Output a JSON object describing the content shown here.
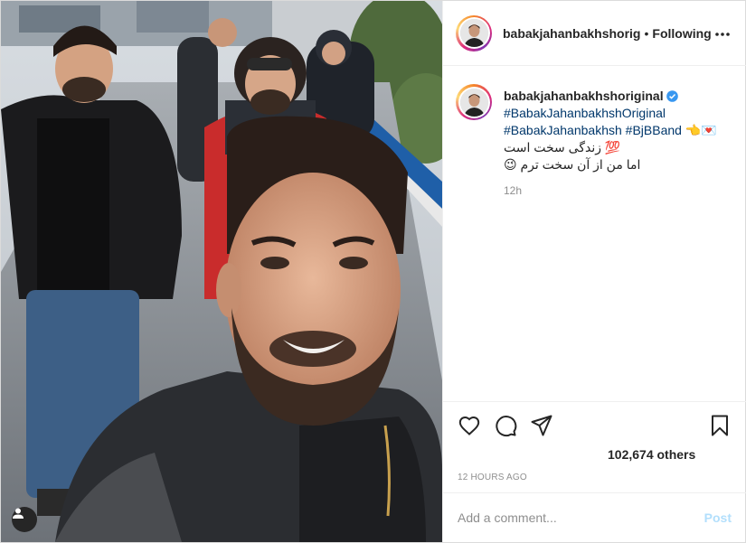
{
  "post": {
    "photo_alt_icon": "user-tag-icon",
    "header": {
      "username": "babakjahanbakhshorig",
      "separator": "•",
      "follow_status": "Following",
      "more_icon": "ellipsis-icon"
    },
    "caption": {
      "username": "babakjahanbakhshoriginal",
      "verified_icon": "verified-badge-icon",
      "hashtag_1": "#BabakJahanbakhshOriginal",
      "hashtag_2": "#BabakJahanbakhsh",
      "hashtag_3": "#BjBBand",
      "hashtag_3_emoji": "👈💌",
      "line_1": "💯 زندگی سخت است",
      "line_2": "اما من از آن سخت ترم 😉",
      "time_ago": "12h"
    },
    "actions": {
      "like_icon": "heart-icon",
      "comment_icon": "comment-icon",
      "share_icon": "paper-plane-icon",
      "save_icon": "bookmark-icon"
    },
    "likes_text": "102,674 others",
    "timestamp": "12 HOURS AGO",
    "comment": {
      "placeholder": "Add a comment...",
      "post_label": "Post"
    },
    "colors": {
      "hashtag": "#00376b",
      "post_button_disabled": "#b2dffc",
      "verified": "#3897f0"
    }
  }
}
